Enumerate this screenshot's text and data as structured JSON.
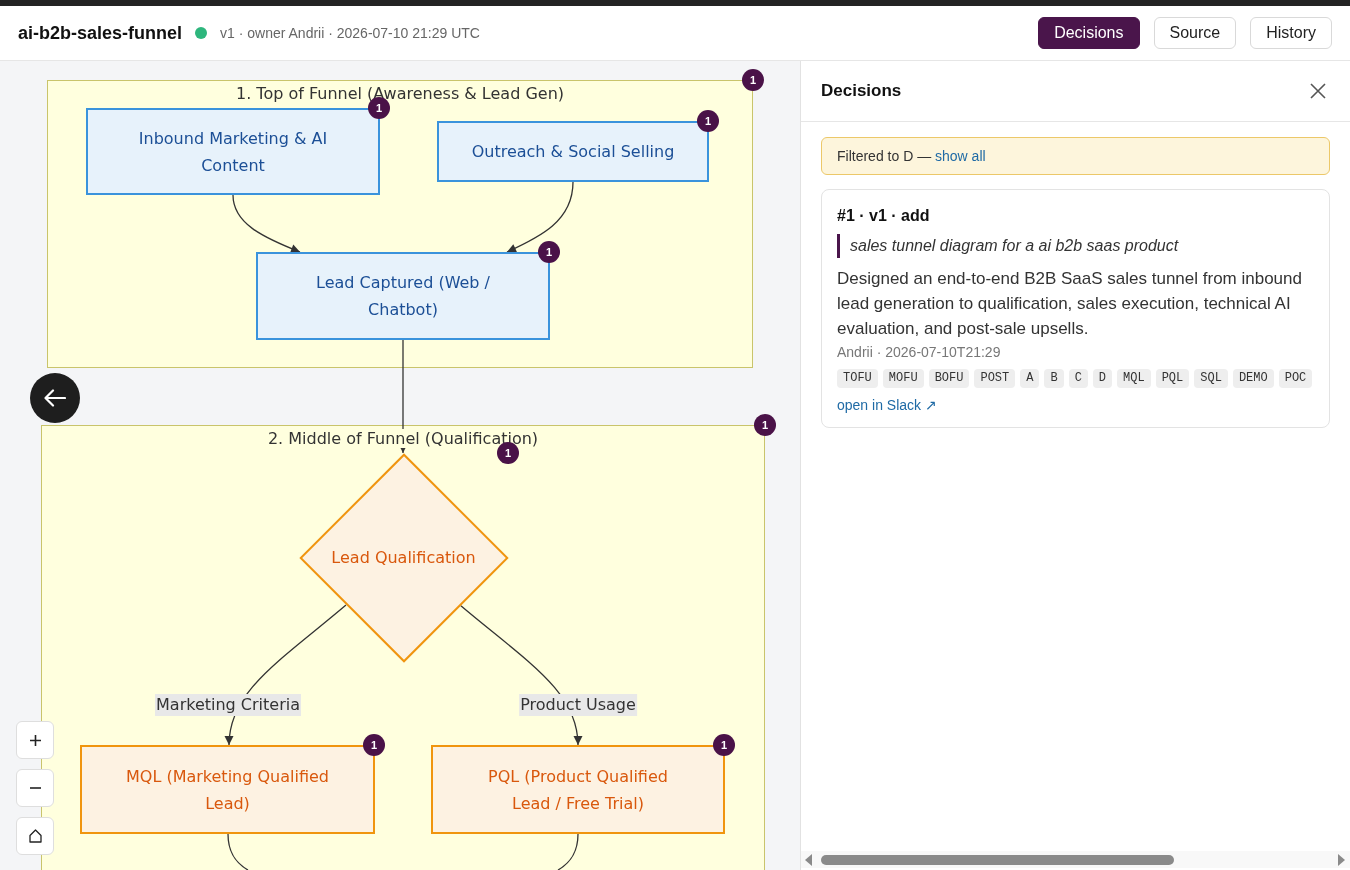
{
  "header": {
    "title": "ai-b2b-sales-funnel",
    "active": true,
    "meta": "v1 · owner Andrii · 2026-07-10 21:29 UTC",
    "buttons": [
      {
        "label": "Decisions",
        "selected": true
      },
      {
        "label": "Source",
        "selected": false
      },
      {
        "label": "History",
        "selected": false
      }
    ]
  },
  "diagram": {
    "clusters": [
      {
        "title": "1. Top of Funnel (Awareness & Lead Gen)",
        "badge": "1",
        "nodes": [
          {
            "kind": "box",
            "label": "Inbound Marketing & AI Content",
            "color": "#3a93dc",
            "badge": "1"
          },
          {
            "kind": "box",
            "label": "Outreach & Social Selling",
            "color": "#3a93dc",
            "badge": "1"
          },
          {
            "kind": "box",
            "label": "Lead Captured (Web / Chatbot)",
            "color": "#3a93dc",
            "badge": "1"
          }
        ]
      },
      {
        "title": "2. Middle of Funnel (Qualification)",
        "badge": "1",
        "nodes": [
          {
            "kind": "decision",
            "label": "Lead Qualification",
            "color": "#f0950e",
            "badge": "1"
          },
          {
            "kind": "box",
            "label": "MQL (Marketing Qualified Lead)",
            "color": "#f0950e",
            "badge": "1"
          },
          {
            "kind": "box",
            "label": "PQL (Product Qualified Lead / Free Trial)",
            "color": "#f0950e",
            "badge": "1"
          }
        ],
        "edge_labels": [
          "Marketing Criteria",
          "Product Usage"
        ]
      }
    ]
  },
  "panel": {
    "title": "Decisions",
    "filter": {
      "text": "Filtered to D —",
      "link": "show all"
    },
    "decisions": [
      {
        "heading": "#1 · v1 · add",
        "prompt": "sales tunnel diagram for a ai b2b saas product",
        "summary": "Designed an end-to-end B2B SaaS sales tunnel from inbound lead generation to qualification, sales execution, technical AI evaluation, and post-sale upsells.",
        "meta": "Andrii · 2026-07-10T21:29",
        "tags": [
          "TOFU",
          "MOFU",
          "BOFU",
          "POST",
          "A",
          "B",
          "C",
          "D",
          "MQL",
          "PQL",
          "SQL",
          "DEMO",
          "POC"
        ],
        "link": "open in Slack ↗"
      }
    ]
  }
}
